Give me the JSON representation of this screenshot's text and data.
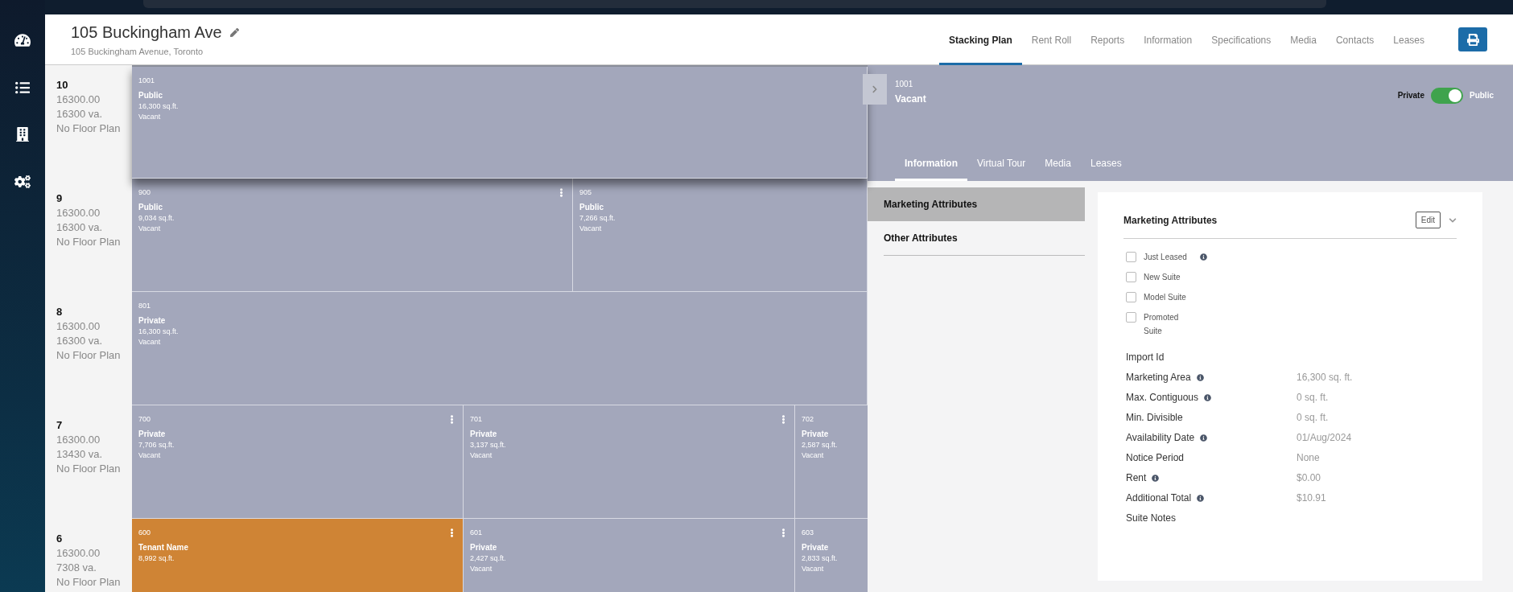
{
  "header": {
    "title": "105 Buckingham Ave",
    "subtitle": "105 Buckingham Avenue, Toronto"
  },
  "nav": [
    {
      "label": "Stacking Plan",
      "selected": true
    },
    {
      "label": "Rent Roll",
      "selected": false
    },
    {
      "label": "Reports",
      "selected": false
    },
    {
      "label": "Information",
      "selected": false
    },
    {
      "label": "Specifications",
      "selected": false
    },
    {
      "label": "Media",
      "selected": false
    },
    {
      "label": "Contacts",
      "selected": false
    },
    {
      "label": "Leases",
      "selected": false
    }
  ],
  "floors": [
    {
      "floor": "10",
      "area": "16300.00",
      "vacant": "16300 va.",
      "plan": "No Floor Plan",
      "raised": true,
      "units": [
        {
          "number": "1001",
          "label": "Public",
          "area": "16,300 sq.ft.",
          "status": "Vacant",
          "menu": false,
          "color": "#a3a7bb"
        }
      ]
    },
    {
      "floor": "9",
      "area": "16300.00",
      "vacant": "16300 va.",
      "plan": "No Floor Plan",
      "raised": false,
      "units": [
        {
          "number": "900",
          "label": "Public",
          "area": "9,034 sq.ft.",
          "status": "Vacant",
          "menu": true,
          "color": "#a3a7bb"
        },
        {
          "number": "905",
          "label": "Public",
          "area": "7,266 sq.ft.",
          "status": "Vacant",
          "menu": false,
          "color": "#a3a7bb"
        }
      ]
    },
    {
      "floor": "8",
      "area": "16300.00",
      "vacant": "16300 va.",
      "plan": "No Floor Plan",
      "raised": false,
      "units": [
        {
          "number": "801",
          "label": "Private",
          "area": "16,300 sq.ft.",
          "status": "Vacant",
          "menu": false,
          "color": "#a3a7bb"
        }
      ]
    },
    {
      "floor": "7",
      "area": "16300.00",
      "vacant": "13430 va.",
      "plan": "No Floor Plan",
      "raised": false,
      "units": [
        {
          "number": "700",
          "label": "Private",
          "area": "7,706 sq.ft.",
          "status": "Vacant",
          "menu": true,
          "color": "#a3a7bb"
        },
        {
          "number": "701",
          "label": "Private",
          "area": "3,137 sq.ft.",
          "status": "Vacant",
          "menu": true,
          "color": "#a3a7bb"
        },
        {
          "number": "702",
          "label": "Private",
          "area": "2,587 sq.ft.",
          "status": "Vacant",
          "menu": false,
          "color": "#a3a7bb"
        }
      ]
    },
    {
      "floor": "6",
      "area": "16300.00",
      "vacant": "7308 va.",
      "plan": "No Floor Plan",
      "raised": false,
      "units": [
        {
          "number": "600",
          "label": "Tenant Name",
          "area": "8,992 sq.ft.",
          "menu": true,
          "color": "#cf8435"
        },
        {
          "number": "601",
          "label": "Private",
          "area": "2,427 sq.ft.",
          "status": "Vacant",
          "menu": true,
          "color": "#a3a7bb"
        },
        {
          "number": "603",
          "label": "Private",
          "area": "2,833 sq.ft.",
          "status": "Vacant",
          "menu": false,
          "color": "#a3a7bb"
        }
      ]
    }
  ],
  "panel": {
    "number": "1001",
    "status": "Vacant",
    "toggle": {
      "left": "Private",
      "right": "Public",
      "on": true
    },
    "tabs": [
      {
        "label": "Information",
        "selected": true
      },
      {
        "label": "Virtual Tour",
        "selected": false
      },
      {
        "label": "Media",
        "selected": false
      },
      {
        "label": "Leases",
        "selected": false
      }
    ],
    "sections": [
      {
        "label": "Marketing Attributes",
        "selected": true
      },
      {
        "label": "Other Attributes",
        "selected": false
      }
    ],
    "card": {
      "title": "Marketing Attributes",
      "edit": "Edit",
      "checks": [
        {
          "label": "Just Leased",
          "checked": false,
          "info": true
        },
        {
          "label": "New Suite",
          "checked": false,
          "info": false
        },
        {
          "label": "Model Suite",
          "checked": false,
          "info": false
        },
        {
          "label": "Promoted Suite",
          "checked": false,
          "info": false
        }
      ],
      "fields": [
        {
          "label": "Import Id",
          "info": false
        },
        {
          "label": "Marketing Area",
          "info": true,
          "value": "16,300 sq. ft."
        },
        {
          "label": "Max. Contiguous",
          "info": true,
          "value": "0 sq. ft."
        },
        {
          "label": "Min. Divisible",
          "info": false,
          "value": "0 sq. ft."
        },
        {
          "label": "Availability Date",
          "info": true,
          "value": "01/Aug/2024"
        },
        {
          "label": "Notice Period",
          "info": false,
          "value": "None"
        },
        {
          "label": "Rent",
          "info": true,
          "value": "$0.00"
        },
        {
          "label": "Additional Total",
          "info": true,
          "value": "$10.91"
        },
        {
          "label": "Suite Notes",
          "info": false
        }
      ]
    }
  }
}
